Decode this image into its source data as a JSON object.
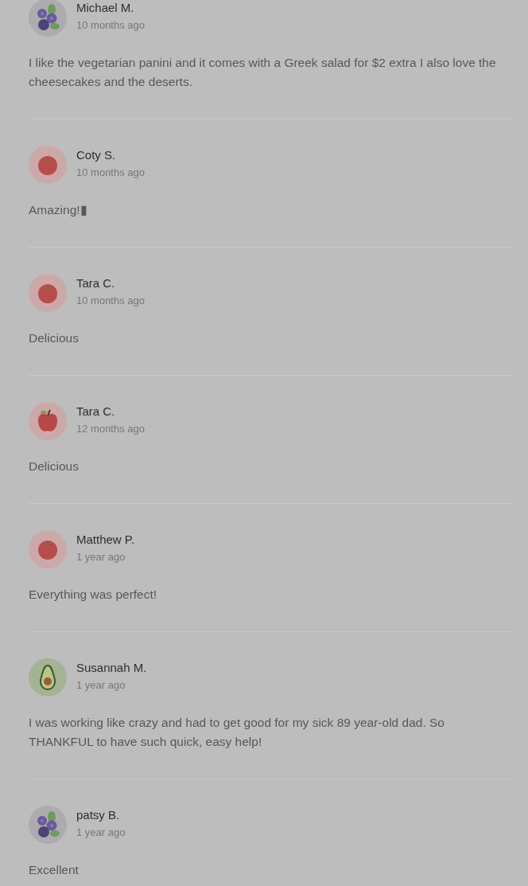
{
  "reviews": [
    {
      "avatar": {
        "kind": "blueberries"
      },
      "name": "Michael M.",
      "time": "10 months ago",
      "text": "I like the vegetarian panini and it comes with a Greek salad for $2 extra I also love the cheesecakes and the deserts."
    },
    {
      "avatar": {
        "kind": "tomato"
      },
      "name": "Coty S.",
      "time": "10 months ago",
      "text": "Amazing!▮"
    },
    {
      "avatar": {
        "kind": "tomato"
      },
      "name": "Tara C.",
      "time": "10 months ago",
      "text": "Delicious"
    },
    {
      "avatar": {
        "kind": "apple"
      },
      "name": "Tara C.",
      "time": "12 months ago",
      "text": "Delicious"
    },
    {
      "avatar": {
        "kind": "tomato"
      },
      "name": "Matthew P.",
      "time": "1 year ago",
      "text": "Everything was perfect!"
    },
    {
      "avatar": {
        "kind": "avocado"
      },
      "name": "Susannah M.",
      "time": "1 year ago",
      "text": "I was working like crazy and had to get good for my sick 89 year-old dad. So THANKFUL to have such quick, easy help!"
    },
    {
      "avatar": {
        "kind": "blueberries"
      },
      "name": "patsy B.",
      "time": "1 year ago",
      "text": "Excellent"
    }
  ]
}
